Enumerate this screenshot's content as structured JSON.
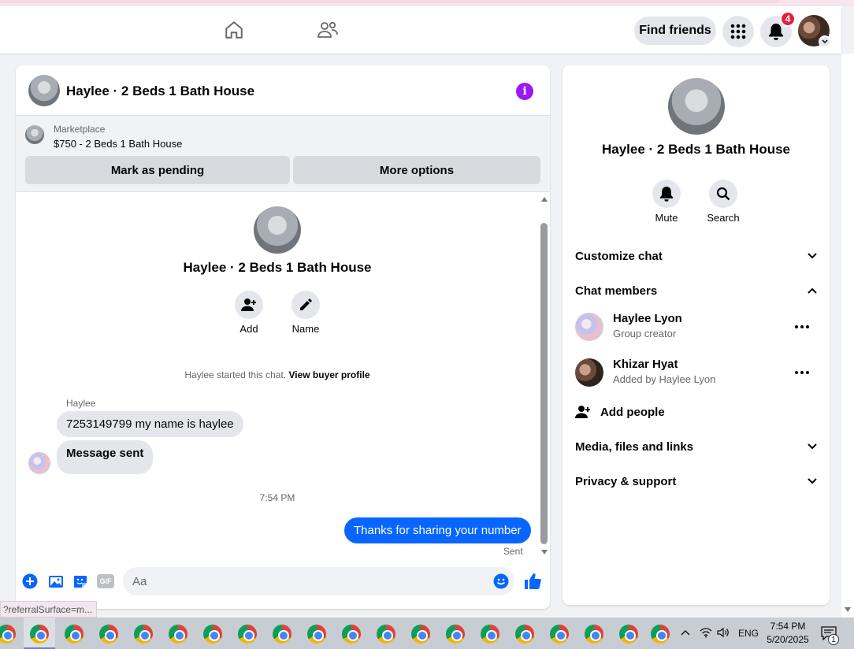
{
  "topbar": {
    "find_friends": "Find friends",
    "notification_count": "4"
  },
  "chat": {
    "title": "Haylee · 2 Beds 1 Bath House",
    "marketplace_label": "Marketplace",
    "listing": "$750 - 2 Beds 1 Bath House",
    "mark_pending": "Mark as pending",
    "more_options": "More options",
    "center_name": "Haylee · 2 Beds 1 Bath House",
    "add_label": "Add",
    "name_label": "Name",
    "started_text": "Haylee started this chat.",
    "view_buyer": "View buyer profile",
    "sender": "Haylee",
    "messages_in": [
      "7253149799 my name is haylee",
      "Message sent"
    ],
    "time": "7:54 PM",
    "message_out": "Thanks for sharing your number",
    "sent_status": "Sent",
    "composer_placeholder": "Aa",
    "gif_label": "GIF"
  },
  "details": {
    "name": "Haylee · 2 Beds 1 Bath House",
    "mute": "Mute",
    "search": "Search",
    "customize_chat": "Customize chat",
    "chat_members": "Chat members",
    "members": [
      {
        "name": "Haylee Lyon",
        "role": "Group creator"
      },
      {
        "name": "Khizar Hyat",
        "role": "Added by Haylee Lyon"
      }
    ],
    "add_people": "Add people",
    "media": "Media, files and links",
    "privacy": "Privacy & support"
  },
  "status_url": "?referralSurface=m...",
  "taskbar": {
    "language": "ENG",
    "time": "7:54 PM",
    "date": "5/20/2025",
    "notification_count": "1"
  },
  "colors": {
    "accent": "#0866ff",
    "info": "#9b19f5",
    "badge": "#e41e3f"
  }
}
